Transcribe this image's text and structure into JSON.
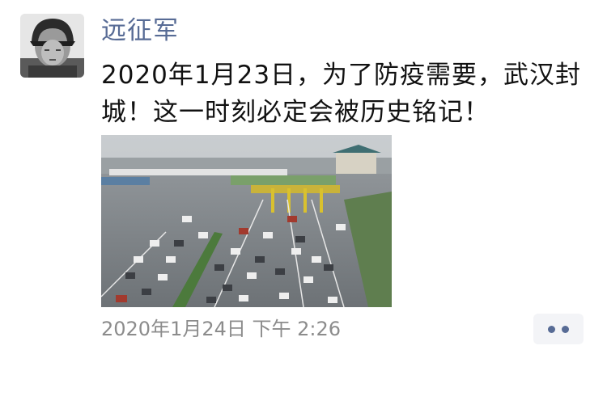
{
  "post": {
    "username": "远征军",
    "content": "2020年1月23日，为了防疫需要，武汉封城！这一时刻必定会被历史铭记！",
    "timestamp": "2020年1月24日 下午 2:26"
  },
  "icons": {
    "avatar": "avatar-helmet-portrait",
    "more": "more-dots-icon"
  },
  "colors": {
    "username": "#576b95",
    "text": "#111111",
    "timestamp": "#8c8c8c",
    "more_button_bg": "#f3f4f7"
  }
}
